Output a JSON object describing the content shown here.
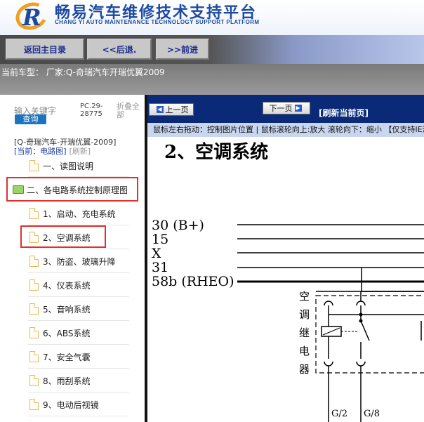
{
  "header": {
    "title": "畅易汽车维修技术支持平台",
    "subtitle": "CHANG YI AUTO MAINTENANCE TECHNOLOGY SUPPORT PLATFORM",
    "logo_letter": "R"
  },
  "navbar": {
    "home_label": "返回主目录",
    "back_label": "<<后退.",
    "forward_label": ">>前进"
  },
  "car_info": "当前车型：   厂家:Q-奇瑞汽车开瑞优翼2009",
  "sidebar": {
    "keyword_label": "输入关键字",
    "search_label": "查询",
    "pc_code": "PC.29-28775",
    "fold_all": "折叠全部",
    "tree_root": "[Q-奇瑞汽车-开瑞优翼-2009]",
    "current_label": "[当前：电路图]",
    "refresh_label": "[刷新]",
    "items": [
      {
        "label": "一、读图说明"
      },
      {
        "label": "二、各电路系统控制原理图"
      },
      {
        "label": "1、启动、充电系统"
      },
      {
        "label": "2、空调系统"
      },
      {
        "label": "3、防盗、玻璃升降"
      },
      {
        "label": "4、仪表系统"
      },
      {
        "label": "5、音响系统"
      },
      {
        "label": "6、ABS系统"
      },
      {
        "label": "7、安全气囊"
      },
      {
        "label": "8、雨刮系统"
      },
      {
        "label": "9、电动后视镜"
      }
    ]
  },
  "viewer": {
    "prev_label": "上一页",
    "next_label": "下一页",
    "refresh_label": "[刷新当前页]",
    "hint": "鼠标左右拖动：控制图片位置 | 鼠标滚轮向上:放大   滚轮向下：缩小 【仅支持IE浏览器】",
    "diagram": {
      "title": "2、空调系统",
      "lines": [
        "30 (B+)",
        "15",
        "X",
        "31",
        "58b (RHEO)"
      ],
      "relay_chars": [
        "空",
        "调",
        "继",
        "电",
        "器"
      ],
      "pins": [
        "G/2",
        "G/8"
      ]
    }
  },
  "colors": {
    "brand": "#1d4aa0",
    "accent_orange": "#f0a020",
    "highlight_red": "#e03030",
    "viewer_bar": "#0a2a78"
  }
}
